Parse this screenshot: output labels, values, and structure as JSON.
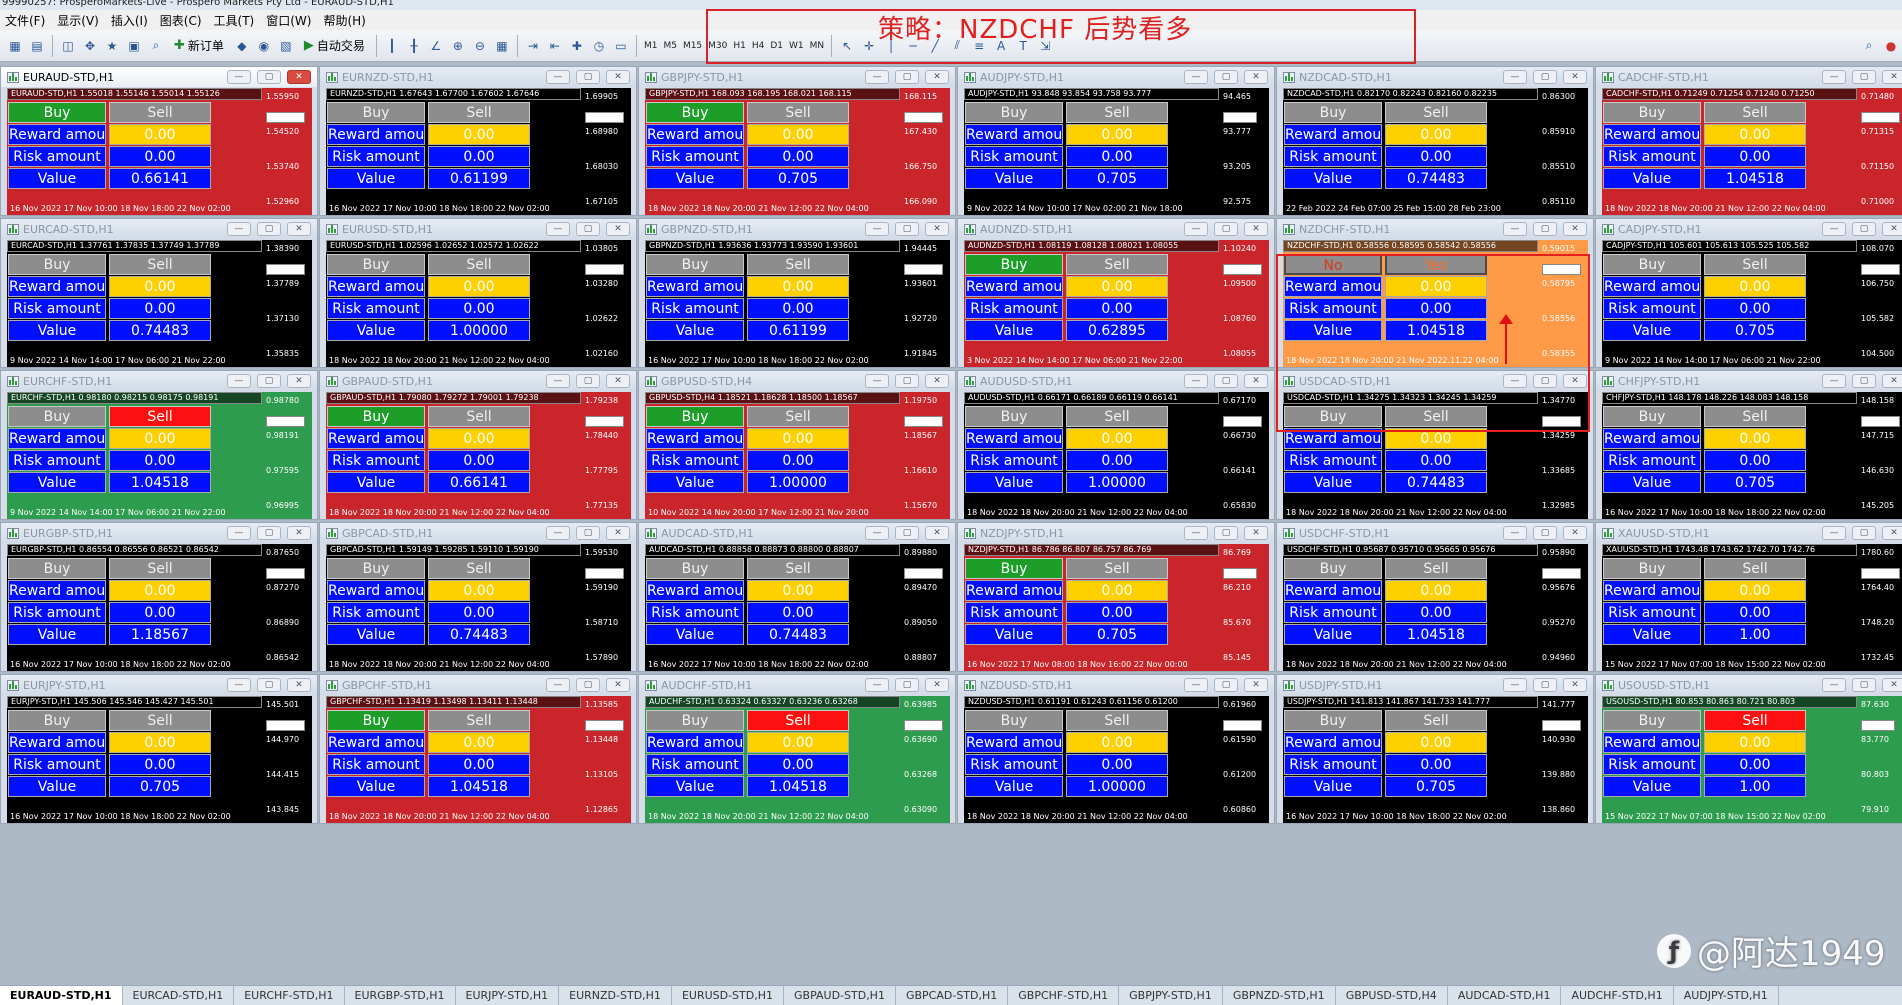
{
  "app": {
    "title": "99990257: ProsperoMarkets-Live - Prospero Markets Pty Ltd - EURAUD-STD,H1"
  },
  "menu": [
    "文件(F)",
    "显示(V)",
    "插入(I)",
    "图表(C)",
    "工具(T)",
    "窗口(W)",
    "帮助(H)"
  ],
  "toolbar": {
    "new_order": "新订单",
    "auto_trade": "自动交易",
    "timeframes": [
      "M1",
      "M5",
      "M15",
      "M30",
      "H1",
      "H4",
      "D1",
      "W1",
      "MN"
    ]
  },
  "strategy": {
    "text": "策略：NZDCHF  后势看多"
  },
  "labels": {
    "buy": "Buy",
    "sell": "Sell",
    "no": "No",
    "yes": "Yes",
    "reward": "Reward amount",
    "risk": "Risk amount",
    "value": "Value"
  },
  "charts": [
    {
      "title": "EURAUD-STD,H1",
      "head": "EURAUD-STD,H1  1.55018 1.55146 1.55014 1.55126",
      "bg": "red",
      "buy": "green",
      "sell": "grey",
      "reward": "0.00",
      "risk": "0.00",
      "value": "0.66141",
      "prices": [
        "1.55950",
        "1.54520",
        "1.53740",
        "1.52960"
      ],
      "tag": "1.55126",
      "time": "16 Nov 2022   17 Nov 10:00   18 Nov 18:00   22 Nov 02:00",
      "active": true
    },
    {
      "title": "EURNZD-STD,H1",
      "head": "EURNZD-STD,H1  1.67643 1.67700 1.67602 1.67646",
      "bg": "black",
      "buy": "grey",
      "sell": "grey",
      "reward": "0.00",
      "risk": "0.00",
      "value": "0.61199",
      "prices": [
        "1.69905",
        "1.68980",
        "1.68030",
        "1.67105"
      ],
      "tag": "1.67646",
      "time": "16 Nov 2022   17 Nov 10:00   18 Nov 18:00   22 Nov 02:00"
    },
    {
      "title": "GBPJPY-STD,H1",
      "head": "GBPJPY-STD,H1  168.093 168.195 168.021 168.115",
      "bg": "red",
      "buy": "green",
      "sell": "grey",
      "reward": "0.00",
      "risk": "0.00",
      "value": "0.705",
      "prices": [
        "168.115",
        "167.430",
        "166.750",
        "166.090"
      ],
      "tag": "168.115",
      "time": "18 Nov 2022   18 Nov 20:00   21 Nov 12:00   22 Nov 04:00"
    },
    {
      "title": "AUDJPY-STD,H1",
      "head": "AUDJPY-STD,H1  93.848 93.854 93.758 93.777",
      "bg": "black",
      "buy": "grey",
      "sell": "grey",
      "reward": "0.00",
      "risk": "0.00",
      "value": "0.705",
      "prices": [
        "94.465",
        "93.777",
        "93.205",
        "92.575"
      ],
      "tag": "93.777",
      "time": "9 Nov 2022   14 Nov 10:00   17 Nov 02:00   21 Nov 18:00"
    },
    {
      "title": "NZDCAD-STD,H1",
      "head": "NZDCAD-STD,H1  0.82170 0.82243 0.82160 0.82235",
      "bg": "black",
      "buy": "grey",
      "sell": "grey",
      "reward": "0.00",
      "risk": "0.00",
      "value": "0.74483",
      "prices": [
        "0.86300",
        "0.85910",
        "0.85510",
        "0.85110"
      ],
      "tag": "",
      "time": "22 Feb 2022   24 Feb 07:00   25 Feb 15:00   28 Feb 23:00"
    },
    {
      "title": "CADCHF-STD,H1",
      "head": "CADCHF-STD,H1  0.71249 0.71254 0.71240 0.71250",
      "bg": "red",
      "buy": "grey",
      "sell": "grey",
      "reward": "0.00",
      "risk": "0.00",
      "value": "1.04518",
      "prices": [
        "0.71480",
        "0.71315",
        "0.71150",
        "0.71000"
      ],
      "tag": "0.71250",
      "time": "18 Nov 2022   18 Nov 20:00   21 Nov 12:00   22 Nov 04:00"
    },
    {
      "title": "EURCAD-STD,H1",
      "head": "EURCAD-STD,H1  1.37761 1.37835 1.37749 1.37789",
      "bg": "black",
      "buy": "grey",
      "sell": "grey",
      "reward": "0.00",
      "risk": "0.00",
      "value": "0.74483",
      "prices": [
        "1.38390",
        "1.37789",
        "1.37130",
        "1.35835"
      ],
      "tag": "1.37789",
      "time": "9 Nov 2022   14 Nov 14:00   17 Nov 06:00   21 Nov 22:00"
    },
    {
      "title": "EURUSD-STD,H1",
      "head": "EURUSD-STD,H1  1.02596 1.02652 1.02572 1.02622",
      "bg": "black",
      "buy": "grey",
      "sell": "grey",
      "reward": "0.00",
      "risk": "0.00",
      "value": "1.00000",
      "prices": [
        "1.03805",
        "1.03280",
        "1.02622",
        "1.02160"
      ],
      "tag": "1.02622",
      "time": "18 Nov 2022   18 Nov 20:00   21 Nov 12:00   22 Nov 04:00"
    },
    {
      "title": "GBPNZD-STD,H1",
      "head": "GBPNZD-STD,H1  1.93636 1.93773 1.93590 1.93601",
      "bg": "black",
      "buy": "grey",
      "sell": "grey",
      "reward": "0.00",
      "risk": "0.00",
      "value": "0.61199",
      "prices": [
        "1.94445",
        "1.93601",
        "1.92720",
        "1.91845"
      ],
      "tag": "1.93601",
      "time": "16 Nov 2022   17 Nov 10:00   18 Nov 18:00   22 Nov 02:00"
    },
    {
      "title": "AUDNZD-STD,H1",
      "head": "AUDNZD-STD,H1  1.08119 1.08128 1.08021 1.08055",
      "bg": "red",
      "buy": "green",
      "sell": "grey",
      "reward": "0.00",
      "risk": "0.00",
      "value": "0.62895",
      "prices": [
        "1.10240",
        "1.09500",
        "1.08760",
        "1.08055"
      ],
      "tag": "1.08055",
      "time": "3 Nov 2022   14 Nov 14:00   17 Nov 06:00   21 Nov 22:00"
    },
    {
      "title": "NZDCHF-STD,H1",
      "head": "NZDCHF-STD,H1  0.58556 0.58595 0.58542 0.58556",
      "bg": "orange",
      "buy": "no",
      "sell": "yes",
      "reward": "0.00",
      "risk": "0.00",
      "value": "1.04518",
      "prices": [
        "0.59015",
        "0.58795",
        "0.58556",
        "0.58355"
      ],
      "tag": "0.58556",
      "time": "18 Nov 2022   18 Nov 20:00   21 Nov   2022.11.22 04:00"
    },
    {
      "title": "CADJPY-STD,H1",
      "head": "CADJPY-STD,H1  105.601 105.613 105.525 105.582",
      "bg": "black",
      "buy": "grey",
      "sell": "grey",
      "reward": "0.00",
      "risk": "0.00",
      "value": "0.705",
      "prices": [
        "108.070",
        "106.750",
        "105.582",
        "104.500"
      ],
      "tag": "105.582",
      "time": "9 Nov 2022   14 Nov 14:00   17 Nov 06:00   21 Nov 22:00"
    },
    {
      "title": "EURCHF-STD,H1",
      "head": "EURCHF-STD,H1  0.98180 0.98215 0.98175 0.98191",
      "bg": "green",
      "buy": "grey",
      "sell": "red",
      "reward": "0.00",
      "risk": "0.00",
      "value": "1.04518",
      "prices": [
        "0.98780",
        "0.98191",
        "0.97595",
        "0.96995"
      ],
      "tag": "0.98191",
      "time": "9 Nov 2022   14 Nov 14:00   17 Nov 06:00   21 Nov 22:00"
    },
    {
      "title": "GBPAUD-STD,H1",
      "head": "GBPAUD-STD,H1  1.79080 1.79272 1.79001 1.79238",
      "bg": "red",
      "buy": "green",
      "sell": "grey",
      "reward": "0.00",
      "risk": "0.00",
      "value": "0.66141",
      "prices": [
        "1.79238",
        "1.78440",
        "1.77795",
        "1.77135"
      ],
      "tag": "1.79238",
      "time": "18 Nov 2022   18 Nov 20:00   21 Nov 12:00   22 Nov 04:00"
    },
    {
      "title": "GBPUSD-STD,H4",
      "head": "GBPUSD-STD,H4  1.18521 1.18628 1.18500 1.18567",
      "bg": "red",
      "buy": "green",
      "sell": "grey",
      "reward": "0.00",
      "risk": "0.00",
      "value": "1.00000",
      "prices": [
        "1.19750",
        "1.18567",
        "1.16610",
        "1.15670"
      ],
      "tag": "1.18567",
      "time": "10 Nov 2022   14 Nov 20:00   17 Nov 12:00   21 Nov 20:00"
    },
    {
      "title": "AUDUSD-STD,H1",
      "head": "AUDUSD-STD,H1  0.66171 0.66189 0.66119 0.66141",
      "bg": "black",
      "buy": "grey",
      "sell": "grey",
      "reward": "0.00",
      "risk": "0.00",
      "value": "1.00000",
      "prices": [
        "0.67170",
        "0.66730",
        "0.66141",
        "0.65830"
      ],
      "tag": "0.66141",
      "time": "18 Nov 2022   18 Nov 20:00   21 Nov 12:00   22 Nov 04:00"
    },
    {
      "title": "USDCAD-STD,H1",
      "head": "USDCAD-STD,H1  1.34275 1.34323 1.34245 1.34259",
      "bg": "black",
      "buy": "grey",
      "sell": "grey",
      "reward": "0.00",
      "risk": "0.00",
      "value": "0.74483",
      "prices": [
        "1.34770",
        "1.34259",
        "1.33685",
        "1.32985"
      ],
      "tag": "1.34259",
      "time": "18 Nov 2022   18 Nov 20:00   21 Nov 12:00   22 Nov 04:00"
    },
    {
      "title": "CHFJPY-STD,H1",
      "head": "CHFJPY-STD,H1  148.178 148.226 148.083 148.158",
      "bg": "black",
      "buy": "grey",
      "sell": "grey",
      "reward": "0.00",
      "risk": "0.00",
      "value": "0.705",
      "prices": [
        "148.158",
        "147.715",
        "146.630",
        "145.205"
      ],
      "tag": "148.158",
      "time": "16 Nov 2022   17 Nov 10:00   18 Nov 18:00   22 Nov 02:00"
    },
    {
      "title": "EURGBP-STD,H1",
      "head": "EURGBP-STD,H1  0.86554 0.86556 0.86521 0.86542",
      "bg": "black",
      "buy": "grey",
      "sell": "grey",
      "reward": "0.00",
      "risk": "0.00",
      "value": "1.18567",
      "prices": [
        "0.87650",
        "0.87270",
        "0.86890",
        "0.86542"
      ],
      "tag": "0.86542",
      "time": "16 Nov 2022   17 Nov 10:00   18 Nov 18:00   22 Nov 02:00"
    },
    {
      "title": "GBPCAD-STD,H1",
      "head": "GBPCAD-STD,H1  1.59149 1.59285 1.59110 1.59190",
      "bg": "black",
      "buy": "grey",
      "sell": "grey",
      "reward": "0.00",
      "risk": "0.00",
      "value": "0.74483",
      "prices": [
        "1.59530",
        "1.59190",
        "1.58710",
        "1.57890"
      ],
      "tag": "1.59190",
      "time": "18 Nov 2022   18 Nov 20:00   21 Nov 12:00   22 Nov 04:00"
    },
    {
      "title": "AUDCAD-STD,H1",
      "head": "AUDCAD-STD,H1  0.88858 0.88873 0.88800 0.88807",
      "bg": "black",
      "buy": "grey",
      "sell": "grey",
      "reward": "0.00",
      "risk": "0.00",
      "value": "0.74483",
      "prices": [
        "0.89880",
        "0.89470",
        "0.89050",
        "0.88807"
      ],
      "tag": "0.88807",
      "time": "16 Nov 2022   17 Nov 10:00   18 Nov 18:00   22 Nov 02:00"
    },
    {
      "title": "NZDJPY-STD,H1",
      "head": "NZDJPY-STD,H1  86.786 86.807 86.757 86.769",
      "bg": "red",
      "buy": "green",
      "sell": "grey",
      "reward": "0.00",
      "risk": "0.00",
      "value": "0.705",
      "prices": [
        "86.769",
        "86.210",
        "85.670",
        "85.145"
      ],
      "tag": "86.769",
      "time": "16 Nov 2022   17 Nov 08:00   18 Nov 16:00   22 Nov 00:00"
    },
    {
      "title": "USDCHF-STD,H1",
      "head": "USDCHF-STD,H1  0.95687 0.95710 0.95665 0.95676",
      "bg": "black",
      "buy": "grey",
      "sell": "grey",
      "reward": "0.00",
      "risk": "0.00",
      "value": "1.04518",
      "prices": [
        "0.95890",
        "0.95676",
        "0.95270",
        "0.94960"
      ],
      "tag": "0.95676",
      "time": "18 Nov 2022   18 Nov 20:00   21 Nov 12:00   22 Nov 04:00"
    },
    {
      "title": "XAUUSD-STD,H1",
      "head": "XAUUSD-STD,H1  1743.48 1743.62 1742.70 1742.76",
      "bg": "black",
      "buy": "grey",
      "sell": "grey",
      "reward": "0.00",
      "risk": "0.00",
      "value": "1.00",
      "prices": [
        "1780.60",
        "1764.40",
        "1748.20",
        "1732.45"
      ],
      "tag": "1742.76",
      "time": "15 Nov 2022   17 Nov 07:00   18 Nov 15:00   22 Nov 02:00"
    },
    {
      "title": "EURJPY-STD,H1",
      "head": "EURJPY-STD,H1  145.506 145.546 145.427 145.501",
      "bg": "black",
      "buy": "grey",
      "sell": "grey",
      "reward": "0.00",
      "risk": "0.00",
      "value": "0.705",
      "prices": [
        "145.501",
        "144.970",
        "144.415",
        "143.845"
      ],
      "tag": "145.501",
      "time": "16 Nov 2022   17 Nov 10:00   18 Nov 18:00   22 Nov 02:00"
    },
    {
      "title": "GBPCHF-STD,H1",
      "head": "GBPCHF-STD,H1  1.13419 1.13498 1.13411 1.13448",
      "bg": "red",
      "buy": "green",
      "sell": "grey",
      "reward": "0.00",
      "risk": "0.00",
      "value": "1.04518",
      "prices": [
        "1.13585",
        "1.13448",
        "1.13105",
        "1.12865"
      ],
      "tag": "1.13448",
      "time": "18 Nov 2022   18 Nov 20:00   21 Nov 12:00   22 Nov 04:00"
    },
    {
      "title": "AUDCHF-STD,H1",
      "head": "AUDCHF-STD,H1  0.63324 0.63327 0.63236 0.63268",
      "bg": "green",
      "buy": "grey",
      "sell": "red",
      "reward": "0.00",
      "risk": "0.00",
      "value": "1.04518",
      "prices": [
        "0.63985",
        "0.63690",
        "0.63268",
        "0.63090"
      ],
      "tag": "0.63268",
      "time": "18 Nov 2022   18 Nov 20:00   21 Nov 12:00   22 Nov 04:00"
    },
    {
      "title": "NZDUSD-STD,H1",
      "head": "NZDUSD-STD,H1  0.61191 0.61243 0.61156 0.61200",
      "bg": "black",
      "buy": "grey",
      "sell": "grey",
      "reward": "0.00",
      "risk": "0.00",
      "value": "1.00000",
      "prices": [
        "0.61960",
        "0.61590",
        "0.61200",
        "0.60860"
      ],
      "tag": "0.61200",
      "time": "18 Nov 2022   18 Nov 20:00   21 Nov 12:00   22 Nov 04:00"
    },
    {
      "title": "USDJPY-STD,H1",
      "head": "USDJPY-STD,H1  141.813 141.867 141.733 141.777",
      "bg": "black",
      "buy": "grey",
      "sell": "grey",
      "reward": "0.00",
      "risk": "0.00",
      "value": "0.705",
      "prices": [
        "141.777",
        "140.930",
        "139.880",
        "138.860"
      ],
      "tag": "141.777",
      "time": "16 Nov 2022   17 Nov 10:00   18 Nov 18:00   22 Nov 02:00"
    },
    {
      "title": "USOUSD-STD,H1",
      "head": "USOUSD-STD,H1  80.853 80.863 80.721 80.803",
      "bg": "green",
      "buy": "grey",
      "sell": "red",
      "reward": "0.00",
      "risk": "0.00",
      "value": "1.00",
      "prices": [
        "87.630",
        "83.770",
        "80.803",
        "79.910"
      ],
      "tag": "80.803",
      "time": "15 Nov 2022   17 Nov 07:00   18 Nov 15:00   22 Nov 02:00"
    }
  ],
  "tabs": [
    "EURAUD-STD,H1",
    "EURCAD-STD,H1",
    "EURCHF-STD,H1",
    "EURGBP-STD,H1",
    "EURJPY-STD,H1",
    "EURNZD-STD,H1",
    "EURUSD-STD,H1",
    "GBPAUD-STD,H1",
    "GBPCAD-STD,H1",
    "GBPCHF-STD,H1",
    "GBPJPY-STD,H1",
    "GBPNZD-STD,H1",
    "GBPUSD-STD,H4",
    "AUDCAD-STD,H1",
    "AUDCHF-STD,H1",
    "AUDJPY-STD,H1"
  ],
  "watermark": {
    "text": "@阿达1949"
  },
  "colors": {
    "red_bg": "#c9252b",
    "green_bg": "#2e9c4f",
    "orange_bg": "#ff9a48",
    "yellow": "#ffd000",
    "blue": "#0010ff",
    "annotation": "#e02020"
  }
}
